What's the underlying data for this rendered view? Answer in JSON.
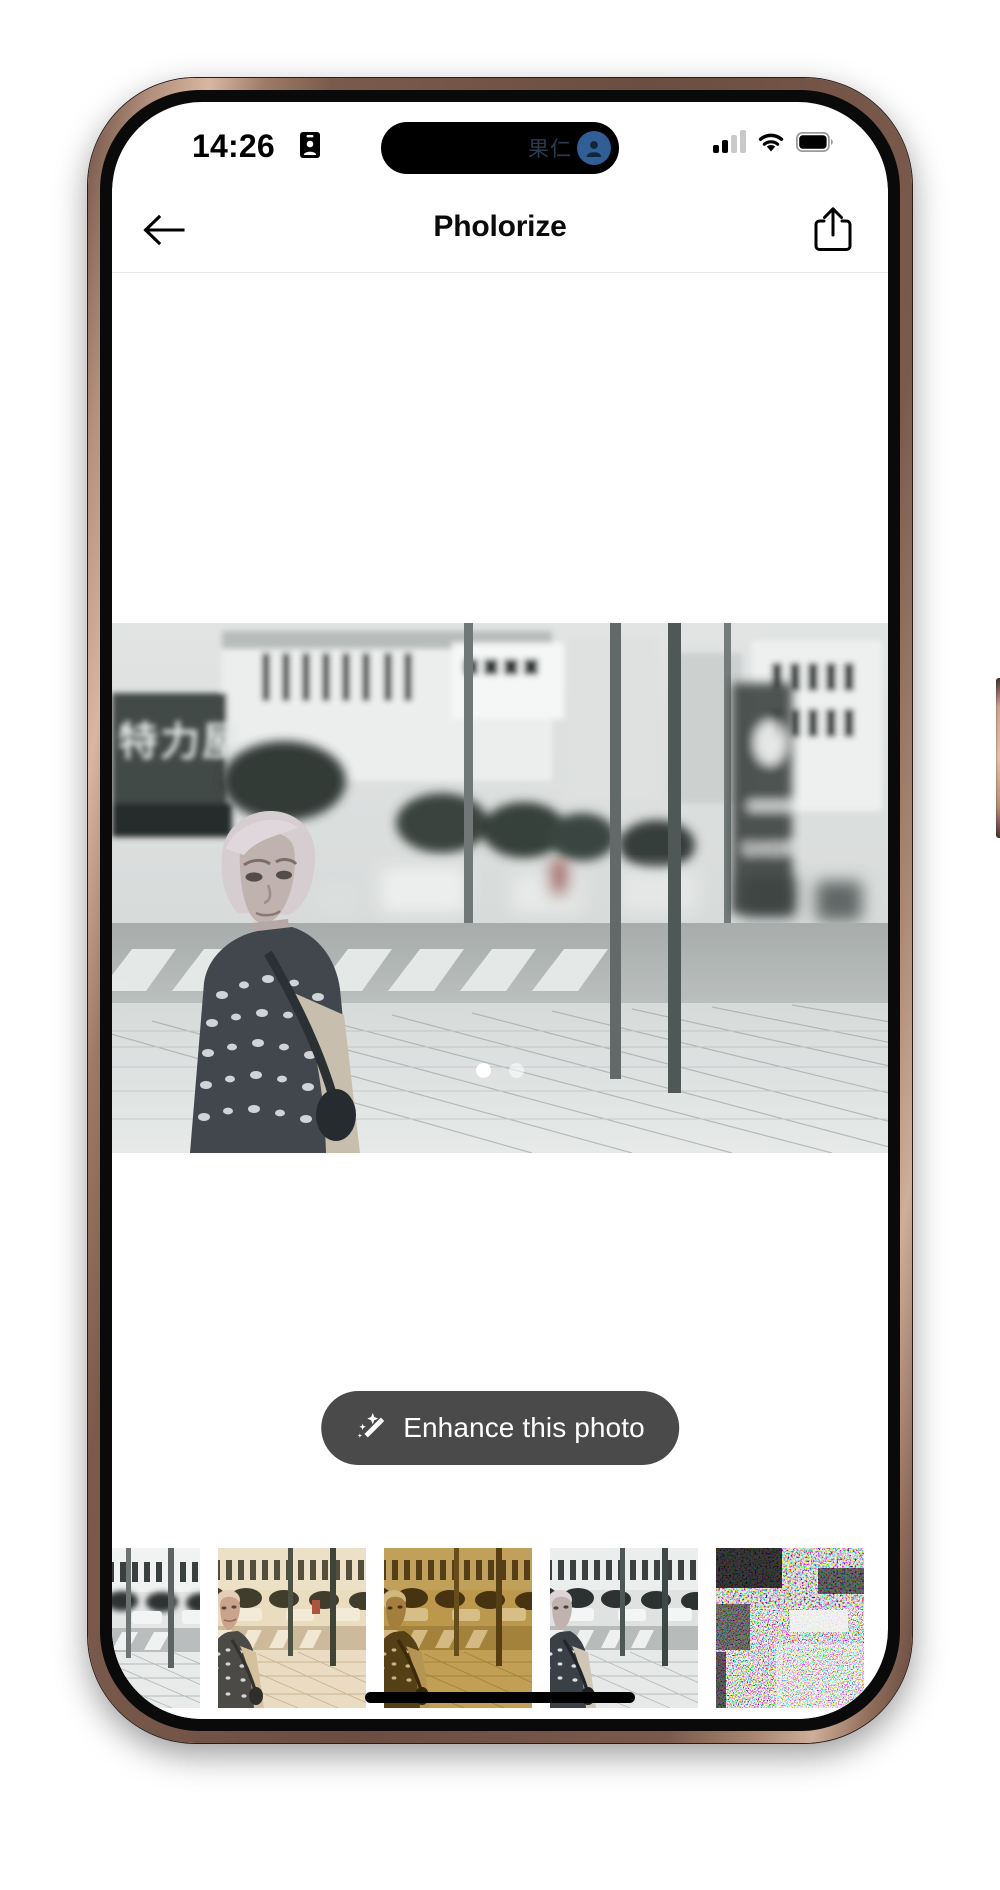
{
  "status_bar": {
    "time": "14:26",
    "contact_icon": "contact-card-icon",
    "signal_icon": "cellular-signal-icon",
    "signal_bars_filled": 2,
    "signal_bars_total": 4,
    "wifi_icon": "wifi-icon",
    "battery_icon": "battery-full-icon",
    "battery_level": 95
  },
  "dynamic_island": {
    "label": "果仁",
    "avatar_icon": "person-avatar-icon",
    "avatar_color": "#2f5f96"
  },
  "nav_bar": {
    "back_icon": "back-arrow-icon",
    "title": "Pholorize",
    "share_icon": "share-export-icon"
  },
  "main": {
    "photo_name": "street-scene-elderly-woman-japan",
    "page_dots": [
      {
        "active": true
      },
      {
        "active": false
      }
    ],
    "enhance_button": {
      "label": "Enhance this photo",
      "icon": "magic-wand-sparkle-icon",
      "background": "#4a4a4a",
      "text_color": "#ffffff"
    }
  },
  "filmstrip": {
    "thumbnails": [
      {
        "name": "filter-thumb-grayscale",
        "filter": "grayscale"
      },
      {
        "name": "filter-thumb-warm-cream",
        "filter": "warm-cream"
      },
      {
        "name": "filter-thumb-sepia-gold",
        "filter": "sepia-gold"
      },
      {
        "name": "filter-thumb-neutral",
        "filter": "neutral"
      },
      {
        "name": "filter-thumb-rainbow-noise",
        "filter": "rainbow-noise"
      }
    ]
  },
  "tab_bar": {
    "active_color": "#E8942A",
    "inactive_color": "#000000",
    "tabs": [
      {
        "name": "tab-gallery",
        "icon": "photo-stack-icon",
        "active": false
      },
      {
        "name": "tab-colorize",
        "icon": "overlapping-circles-icon",
        "active": true
      },
      {
        "name": "tab-curves",
        "icon": "curve-wave-icon",
        "active": false
      },
      {
        "name": "tab-adjustments",
        "icon": "sliders-icon",
        "active": false
      }
    ]
  },
  "home_indicator": {
    "name": "home-indicator-bar"
  }
}
